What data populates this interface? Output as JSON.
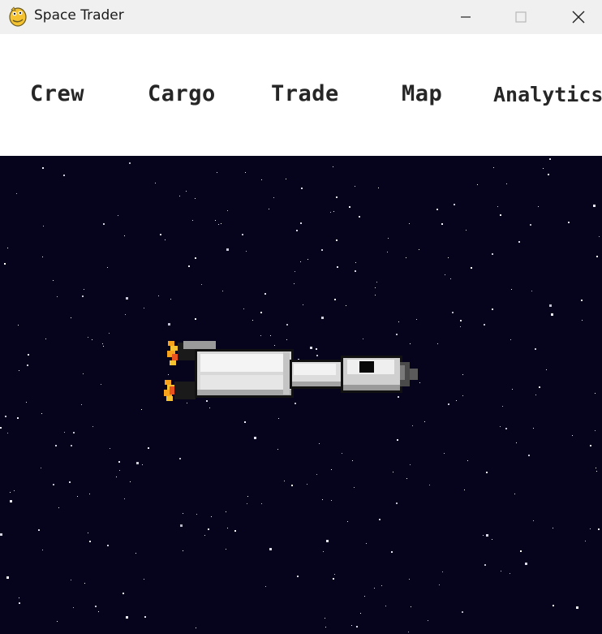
{
  "window": {
    "title": "Space Trader",
    "icon": "pygame-snake-icon"
  },
  "nav": {
    "items": [
      {
        "label": "Crew"
      },
      {
        "label": "Cargo"
      },
      {
        "label": "Trade"
      },
      {
        "label": "Map"
      },
      {
        "label": "Analytics"
      }
    ]
  },
  "colors": {
    "space": "#05041c",
    "nav_text": "#262626",
    "titlebar": "#f0f0f0"
  }
}
